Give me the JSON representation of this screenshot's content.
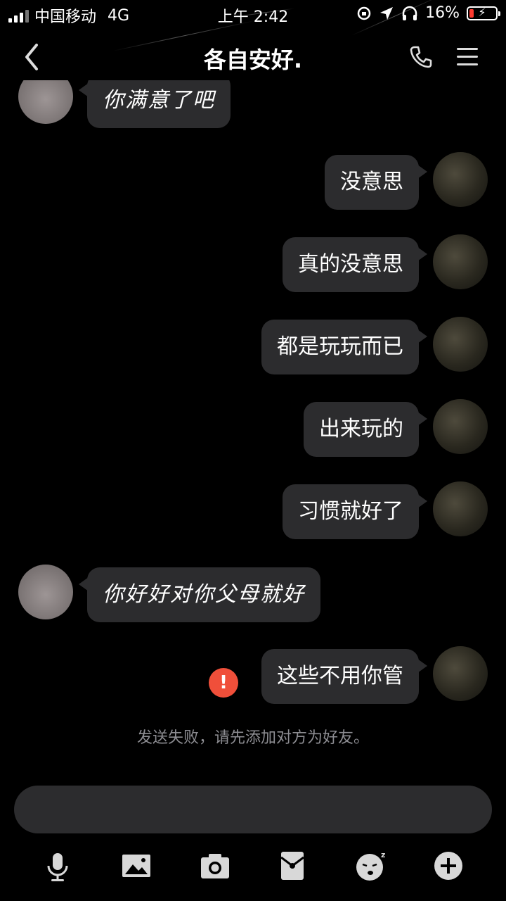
{
  "status_bar": {
    "carrier": "中国移动",
    "network": "4G",
    "time": "上午 2:42",
    "battery": "16%"
  },
  "nav": {
    "title": "各自安好."
  },
  "messages": [
    {
      "side": "in",
      "text": "你满意了吧"
    },
    {
      "side": "out",
      "text": "没意思"
    },
    {
      "side": "out",
      "text": "真的没意思"
    },
    {
      "side": "out",
      "text": "都是玩玩而已"
    },
    {
      "side": "out",
      "text": "出来玩的"
    },
    {
      "side": "out",
      "text": "习惯就好了"
    },
    {
      "side": "in",
      "text": "你好好对你父母就好"
    },
    {
      "side": "out",
      "text": "这些不用你管",
      "failed": true
    }
  ],
  "error_badge": "!",
  "send_notice": "发送失败，请先添加对方为好友。",
  "toolbar": {
    "icons": [
      "microphone-icon",
      "image-icon",
      "camera-icon",
      "red-packet-icon",
      "emoji-icon",
      "plus-icon"
    ]
  },
  "colors": {
    "background": "#000000",
    "bubble": "#2c2c2e",
    "error": "#f04f3a",
    "notice_text": "#8d8d92"
  }
}
